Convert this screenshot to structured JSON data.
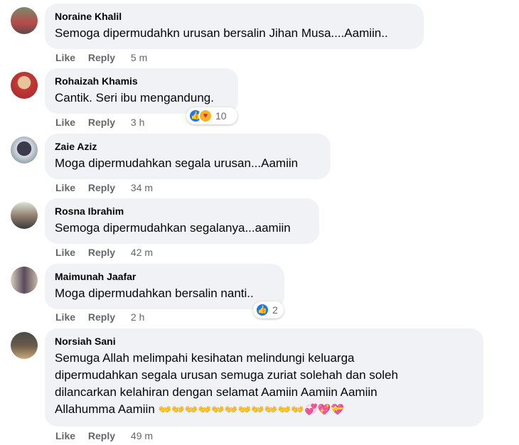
{
  "labels": {
    "like": "Like",
    "reply": "Reply"
  },
  "comments": [
    {
      "name": "Noraine Khalil",
      "text": "Semoga dipermudahkn urusan bersalin Jihan Musa....Aamiin..",
      "time": "5 m"
    },
    {
      "name": "Rohaizah Khamis",
      "text": "Cantik. Seri ibu mengandung.",
      "time": "3 h",
      "reaction_count": "10",
      "reaction_icons": [
        "like-icon",
        "care-icon"
      ]
    },
    {
      "name": "Zaie Aziz",
      "text": "Moga dipermudahkan segala urusan...Aamiin",
      "time": "34 m"
    },
    {
      "name": "Rosna Ibrahim",
      "text": "Semoga dipermudahkan segalanya...aamiin",
      "time": "42 m"
    },
    {
      "name": "Maimunah Jaafar",
      "text": "Moga dipermudahkan bersalin nanti..",
      "time": "2 h",
      "reaction_count": "2",
      "reaction_icons": [
        "like-icon"
      ]
    },
    {
      "name": "Norsiah Sani",
      "text_lines": [
        "Semuga Allah melimpahi kesihatan melindungi keluarga",
        "dipermudahkan segala urusan semuga zuriat solehah dan soleh",
        "dilancarkan kelahiran dengan selamat Aamiin Aamiin Aamiin",
        "Allahumma Aamiin"
      ],
      "emojis": "👐👐👐👐👐👐👐👐👐👐👐💞💖💝",
      "time": "49 m"
    }
  ],
  "colors": {
    "bubble": "#f0f2f5",
    "secondary_text": "#65676b",
    "like_blue": "#1877f2"
  }
}
